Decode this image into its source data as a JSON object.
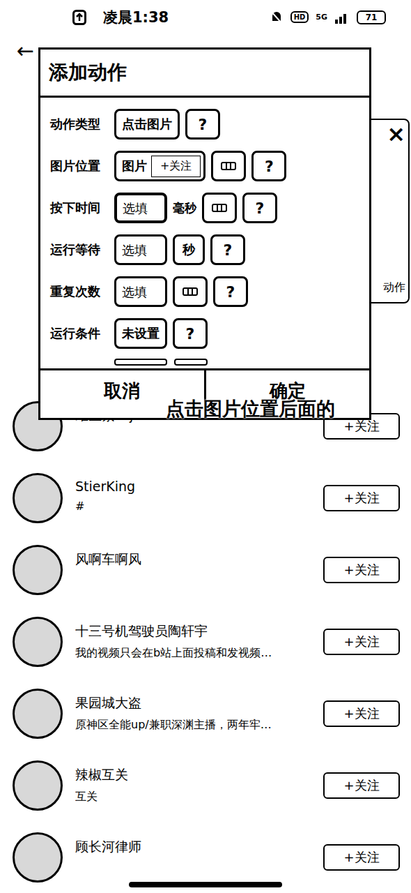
{
  "status_bar": {
    "time": "凌晨1:38",
    "hd": "HD",
    "network": "5G",
    "battery": "71"
  },
  "nav": {
    "back": "←"
  },
  "dialog": {
    "title": "添加动作",
    "rows": [
      {
        "label": "动作类型",
        "kind": "select",
        "value": "点击图片",
        "menu": false,
        "focused": false,
        "help": "?"
      },
      {
        "label": "图片位置",
        "kind": "image",
        "value": "图片",
        "preview": "+关注",
        "menu": true,
        "focused": false,
        "help": "?"
      },
      {
        "label": "按下时间",
        "kind": "input",
        "placeholder": "选填",
        "unit": "毫秒",
        "unit_style": "plain",
        "menu": true,
        "focused": true,
        "help": "?"
      },
      {
        "label": "运行等待",
        "kind": "input",
        "placeholder": "选填",
        "unit": "秒",
        "unit_style": "button",
        "menu": false,
        "focused": false,
        "help": "?"
      },
      {
        "label": "重复次数",
        "kind": "input",
        "placeholder": "选填",
        "menu": true,
        "focused": false,
        "help": "?"
      },
      {
        "label": "运行条件",
        "kind": "select",
        "value": "未设置",
        "menu": false,
        "focused": false,
        "help": "?"
      }
    ],
    "buttons": [
      "取消",
      "确定"
    ]
  },
  "back_panel": {
    "close": "×",
    "label": "动作"
  },
  "caption": "点击图片位置后面的",
  "users": [
    {
      "name": "维生素skjia",
      "bio": "",
      "follow": "+关注"
    },
    {
      "name": "StierKing",
      "bio": "#",
      "follow": "+关注"
    },
    {
      "name": "风啊车啊风",
      "bio": "",
      "follow": "+关注"
    },
    {
      "name": "十三号机驾驶员陶轩宇",
      "bio": "我的视频只会在b站上面投稿和发视频…",
      "follow": "+关注"
    },
    {
      "name": "果园城大盗",
      "bio": "原神区全能up/兼职深渊主播，两年牢…",
      "follow": "+关注"
    },
    {
      "name": "辣椒互关",
      "bio": "互关",
      "follow": "+关注"
    },
    {
      "name": "顾长河律师",
      "bio": "",
      "follow": "+关注"
    }
  ]
}
